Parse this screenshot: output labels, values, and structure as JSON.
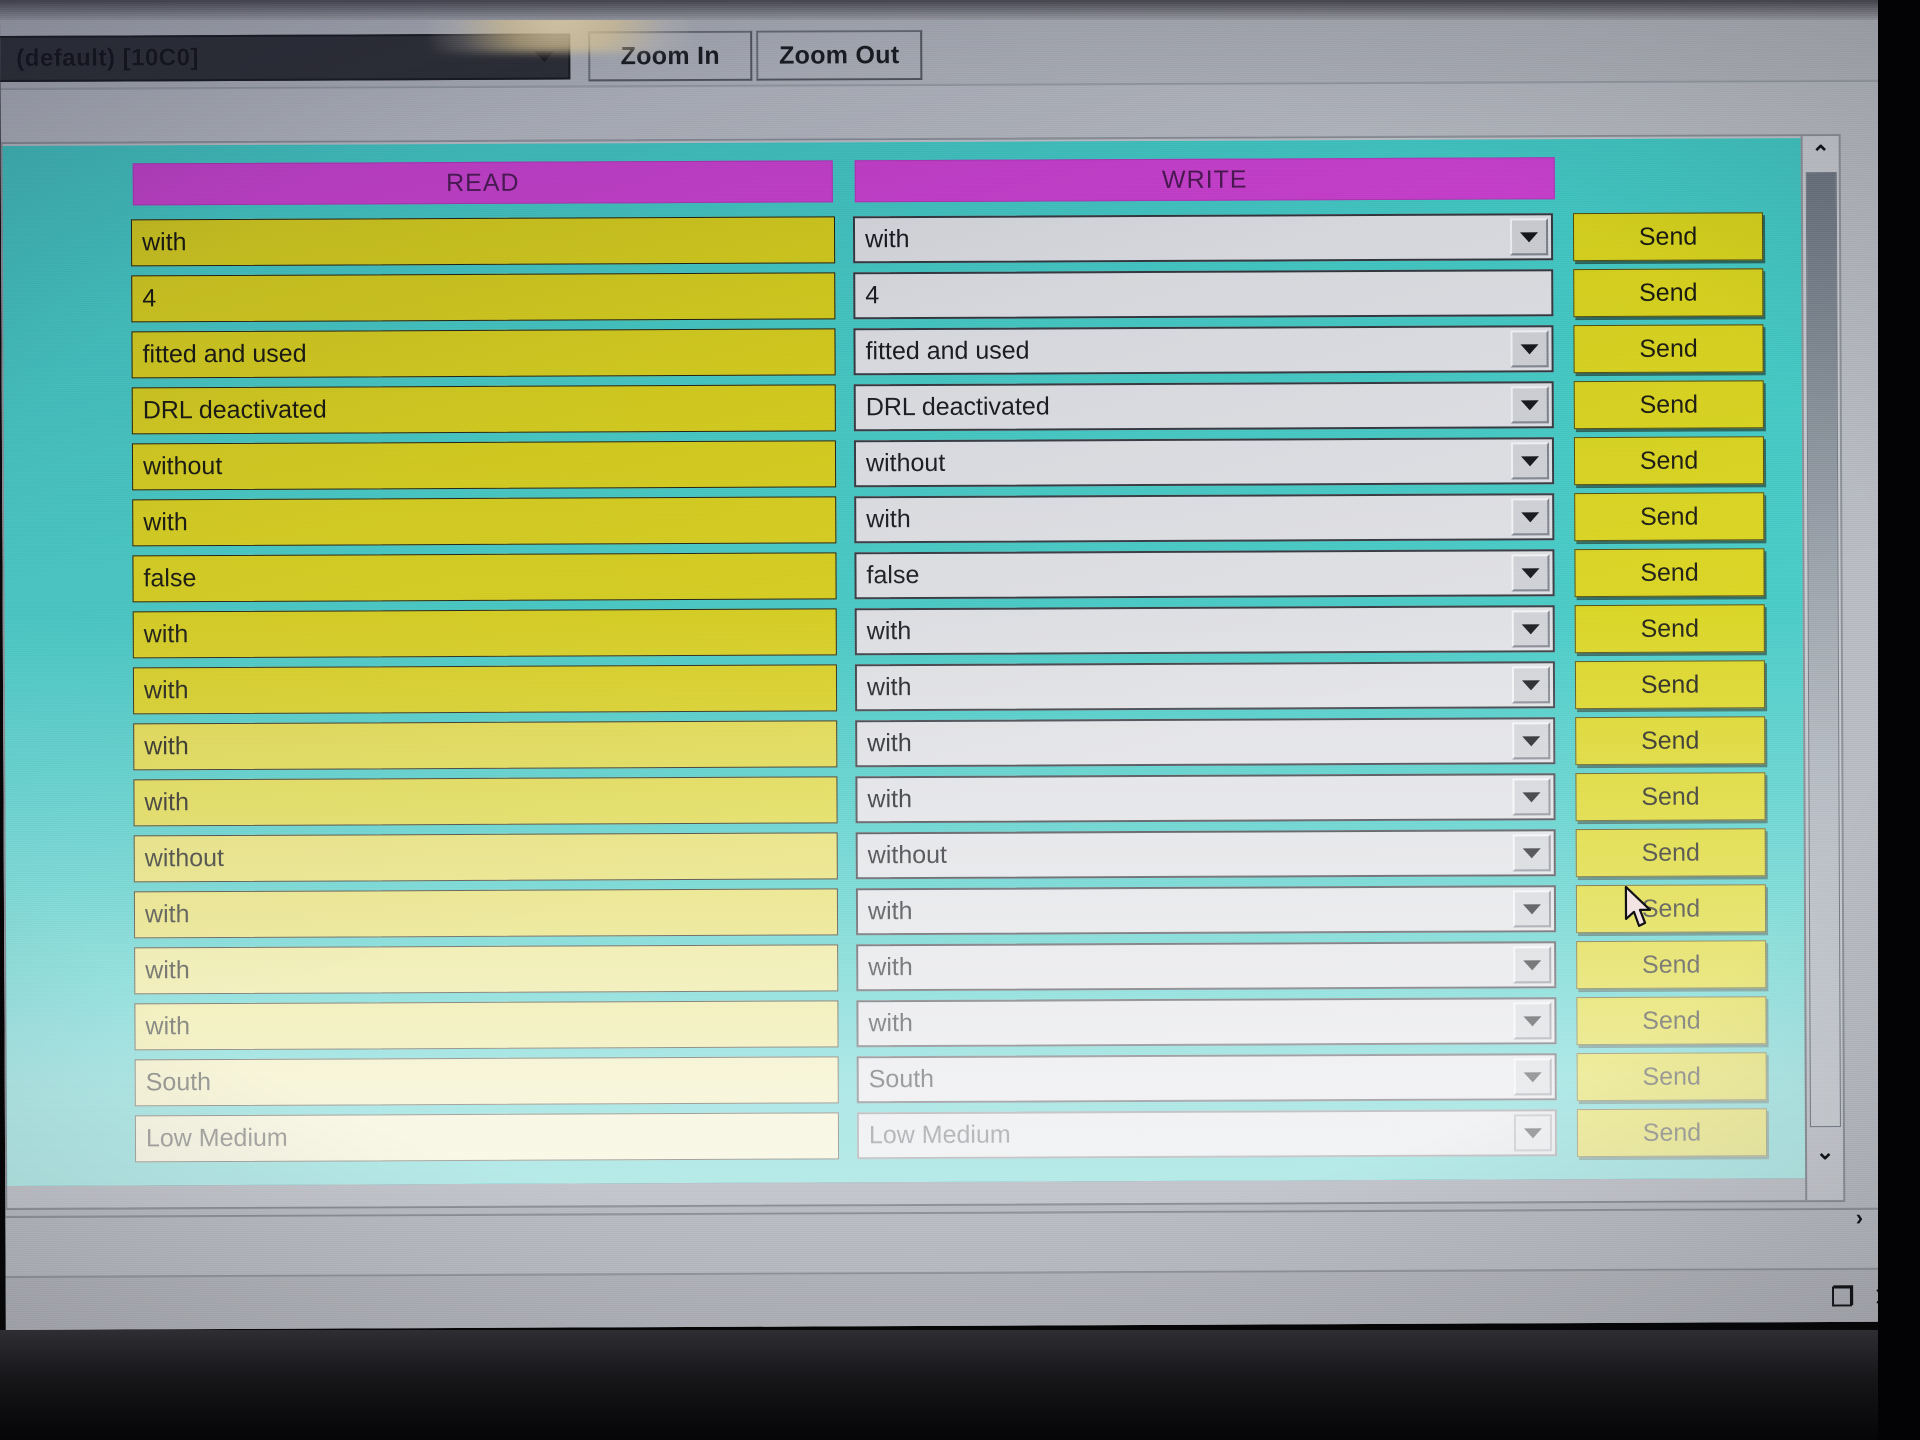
{
  "window": {
    "restore_label": "❐",
    "close_label": "✕"
  },
  "toolbar": {
    "device_combo_value": "(default) [10C0]",
    "zoom_in_label": "Zoom In",
    "zoom_out_label": "Zoom Out",
    "dropdown_icon": "chevron-down-icon"
  },
  "table": {
    "headers": {
      "read": "READ",
      "write": "WRITE"
    },
    "send_label": "Send",
    "rows": [
      {
        "read": "with",
        "write": "with",
        "has_dropdown": true
      },
      {
        "read": "4",
        "write": "4",
        "has_dropdown": false
      },
      {
        "read": "fitted and used",
        "write": "fitted and used",
        "has_dropdown": true
      },
      {
        "read": "DRL deactivated",
        "write": "DRL deactivated",
        "has_dropdown": true
      },
      {
        "read": "without",
        "write": "without",
        "has_dropdown": true
      },
      {
        "read": "with",
        "write": "with",
        "has_dropdown": true
      },
      {
        "read": "false",
        "write": "false",
        "has_dropdown": true
      },
      {
        "read": "with",
        "write": "with",
        "has_dropdown": true
      },
      {
        "read": "with",
        "write": "with",
        "has_dropdown": true
      },
      {
        "read": "with",
        "write": "with",
        "has_dropdown": true
      },
      {
        "read": "with",
        "write": "with",
        "has_dropdown": true
      },
      {
        "read": "without",
        "write": "without",
        "has_dropdown": true
      },
      {
        "read": "with",
        "write": "with",
        "has_dropdown": true
      },
      {
        "read": "with",
        "write": "with",
        "has_dropdown": true
      },
      {
        "read": "with",
        "write": "with",
        "has_dropdown": true
      },
      {
        "read": "South",
        "write": "South",
        "has_dropdown": true
      },
      {
        "read": "Low Medium",
        "write": "Low Medium",
        "has_dropdown": true
      }
    ]
  },
  "scrollbar": {
    "up_label": "⌃",
    "down_label": "⌄",
    "right_label": "›"
  },
  "colors": {
    "header_magenta": "#cc3fd0",
    "panel_teal": "#41c9c4",
    "read_yellow": "#d8cf17",
    "send_yellow": "#d9d41a",
    "write_grey": "#dfe0e4"
  }
}
